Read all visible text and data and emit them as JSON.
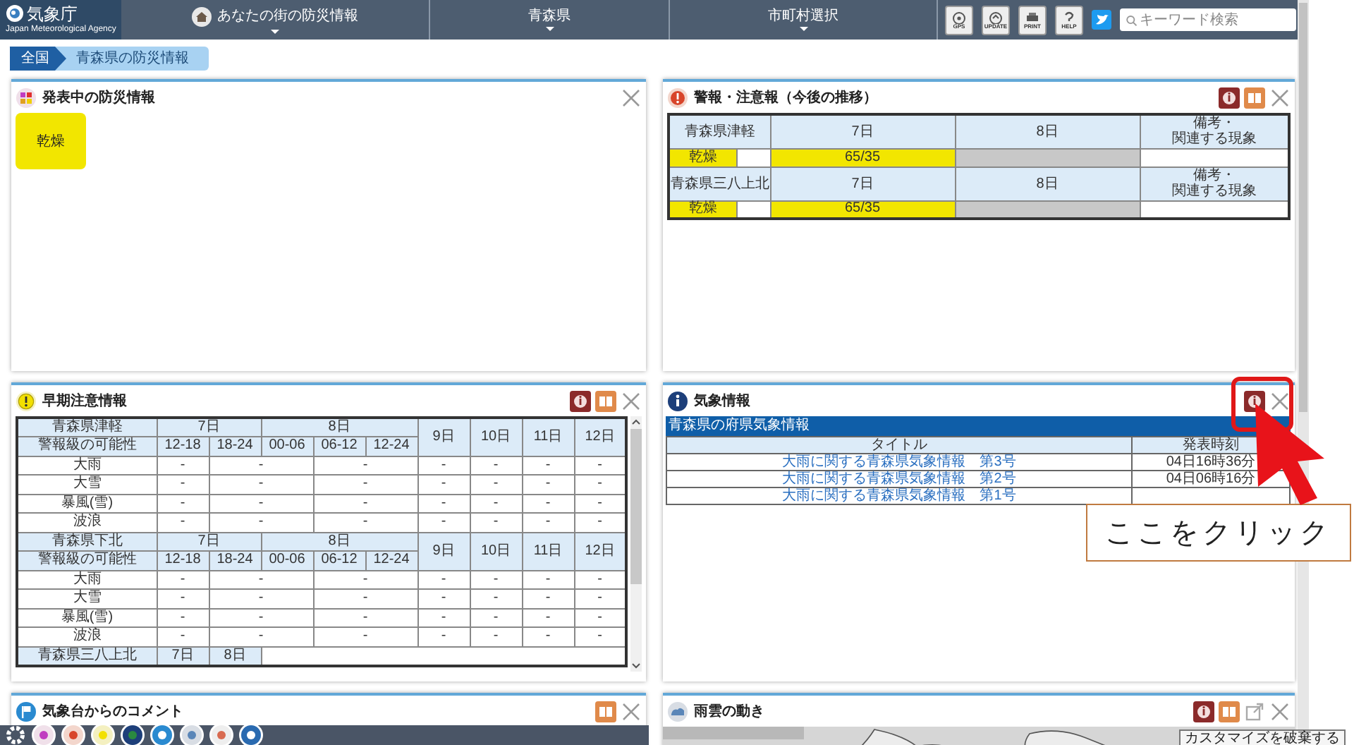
{
  "header": {
    "logo": "気象庁",
    "logo_sub": "Japan Meteorological Agency",
    "nav": [
      {
        "label": "あなたの街の防災情報",
        "kind": "home"
      },
      {
        "label": "青森県",
        "kind": "plain"
      },
      {
        "label": "市町村選択",
        "kind": "plain"
      }
    ],
    "tools": [
      {
        "label": "GPS",
        "kind": "gps"
      },
      {
        "label": "UPDATE",
        "kind": "update"
      },
      {
        "label": "PRINT",
        "kind": "print"
      },
      {
        "label": "HELP",
        "kind": "help"
      }
    ],
    "search": {
      "placeholder": "キーワード検索"
    }
  },
  "breadcrumb": [
    {
      "label": "全国",
      "selected": false
    },
    {
      "label": "青森県の防災情報",
      "selected": true
    }
  ],
  "current_info": {
    "title": "発表中の防災情報",
    "tools": [
      {
        "kind": "close"
      }
    ],
    "tiles": [
      {
        "label": "乾燥",
        "color": "#f2e600"
      }
    ]
  },
  "warnings": {
    "title": "警報・注意報（今後の推移）",
    "tools": [
      {
        "kind": "info"
      },
      {
        "kind": "book"
      },
      {
        "kind": "close"
      }
    ],
    "areas": [
      {
        "name": "青森県津軽",
        "days": [
          "7日",
          "8日"
        ],
        "note_header": [
          "備考・",
          "関連する現象"
        ],
        "items": [
          {
            "label": "乾燥",
            "color": "#f2e600",
            "cells": [
              {
                "text": "65/35",
                "color": "#f2e600"
              },
              {
                "color": "#c8c8c8"
              }
            ]
          }
        ]
      },
      {
        "name": "青森県三八上北",
        "days": [
          "7日",
          "8日"
        ],
        "note_header": [
          "備考・",
          "関連する現象"
        ],
        "items": [
          {
            "label": "乾燥",
            "color": "#f2e600",
            "cells": [
              {
                "text": "65/35",
                "color": "#f2e600"
              },
              {
                "color": "#c8c8c8"
              }
            ]
          }
        ]
      }
    ]
  },
  "early_warning": {
    "title": "早期注意情報",
    "tools": [
      {
        "kind": "info"
      },
      {
        "kind": "book"
      },
      {
        "kind": "close"
      }
    ],
    "areas": [
      {
        "name": "青森県津軽",
        "label": "警報級の可能性",
        "days": [
          {
            "label": "7日",
            "slots": [
              "12-18",
              "18-24"
            ]
          },
          {
            "label": "8日",
            "slots": [
              "00-06",
              "06-12",
              "12-24"
            ]
          },
          {
            "label": "9日"
          },
          {
            "label": "10日"
          },
          {
            "label": "11日"
          },
          {
            "label": "12日"
          }
        ],
        "rows": [
          {
            "hazard": "大雨",
            "values": [
              "-",
              "-",
              "-",
              "-",
              "-",
              "-",
              "-"
            ]
          },
          {
            "hazard": "大雪",
            "values": [
              "-",
              "-",
              "-",
              "-",
              "-",
              "-",
              "-"
            ]
          },
          {
            "hazard": "暴風(雪)",
            "values": [
              "-",
              "-",
              "-",
              "-",
              "-",
              "-",
              "-"
            ]
          },
          {
            "hazard": "波浪",
            "values": [
              "-",
              "-",
              "-",
              "-",
              "-",
              "-",
              "-"
            ]
          }
        ]
      },
      {
        "name": "青森県下北",
        "label": "警報級の可能性",
        "days": [
          {
            "label": "7日",
            "slots": [
              "12-18",
              "18-24"
            ]
          },
          {
            "label": "8日",
            "slots": [
              "00-06",
              "06-12",
              "12-24"
            ]
          },
          {
            "label": "9日"
          },
          {
            "label": "10日"
          },
          {
            "label": "11日"
          },
          {
            "label": "12日"
          }
        ],
        "rows": [
          {
            "hazard": "大雨",
            "values": [
              "-",
              "-",
              "-",
              "-",
              "-",
              "-",
              "-"
            ]
          },
          {
            "hazard": "大雪",
            "values": [
              "-",
              "-",
              "-",
              "-",
              "-",
              "-",
              "-"
            ]
          },
          {
            "hazard": "暴風(雪)",
            "values": [
              "-",
              "-",
              "-",
              "-",
              "-",
              "-",
              "-"
            ]
          },
          {
            "hazard": "波浪",
            "values": [
              "-",
              "-",
              "-",
              "-",
              "-",
              "-",
              "-"
            ]
          }
        ]
      },
      {
        "name": "青森県三八上北",
        "days": [
          {
            "label": "7日"
          },
          {
            "label": "8日"
          }
        ]
      }
    ]
  },
  "weather_info": {
    "title": "気象情報",
    "tools": [
      {
        "kind": "info"
      },
      {
        "kind": "close"
      }
    ],
    "section": "青森県の府県気象情報",
    "columns": [
      "タイトル",
      "発表時刻"
    ],
    "rows": [
      {
        "title": "大雨に関する青森県気象情報　第3号",
        "time": "04日16時36分"
      },
      {
        "title": "大雨に関する青森県気象情報　第2号",
        "time": "04日06時16分"
      },
      {
        "title": "大雨に関する青森県気象情報　第1号"
      }
    ]
  },
  "comment": {
    "title": "気象台からのコメント",
    "tools": [
      {
        "kind": "book"
      },
      {
        "kind": "close"
      }
    ]
  },
  "rain_clouds": {
    "title": "雨雲の動き",
    "tools": [
      {
        "kind": "info"
      },
      {
        "kind": "book"
      },
      {
        "kind": "external"
      },
      {
        "kind": "close"
      }
    ]
  },
  "tooltip": "カスタマイズを破棄する",
  "callout": "ここをクリック"
}
